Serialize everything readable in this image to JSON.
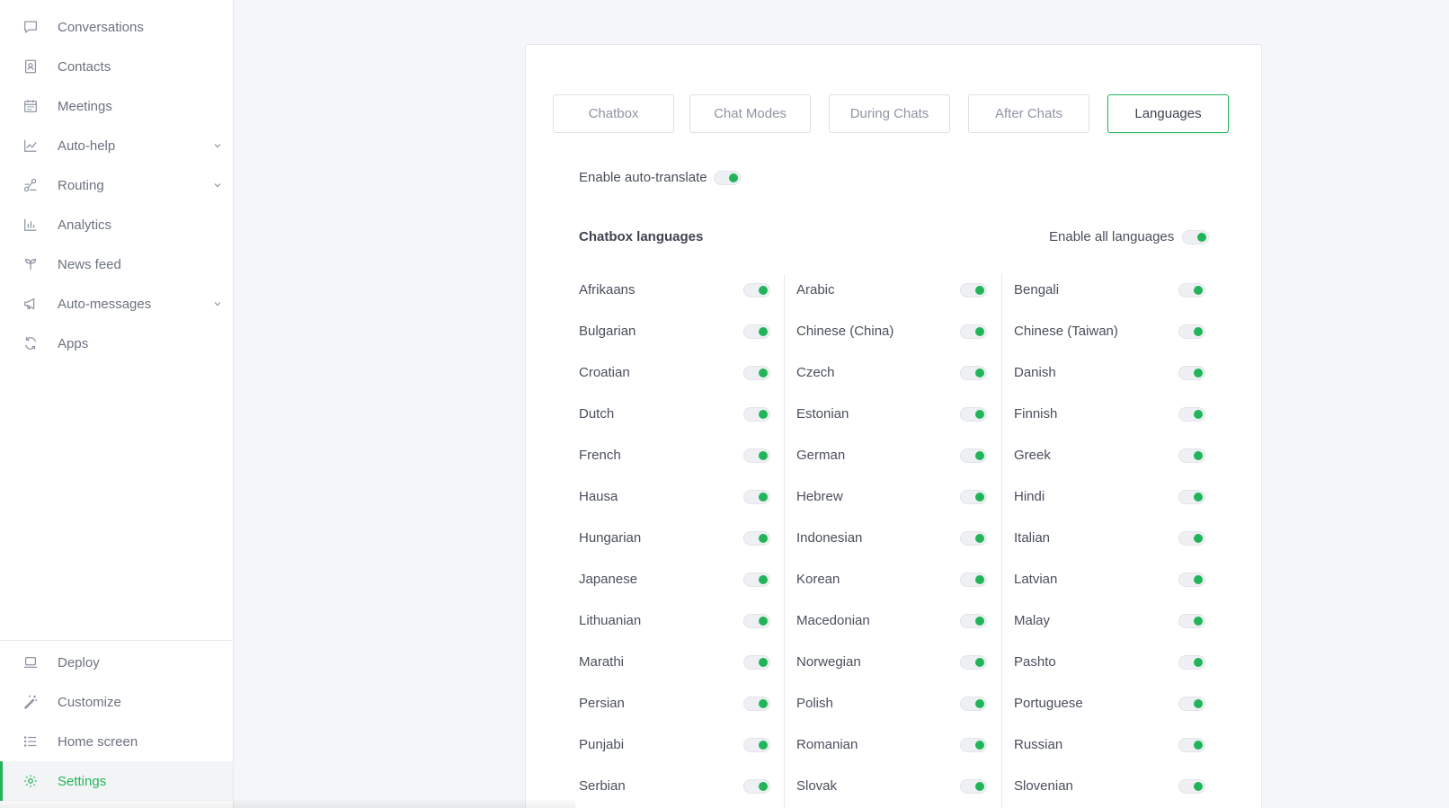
{
  "sidebar": {
    "items": [
      {
        "label": "Conversations",
        "icon": "chat-bubble-icon",
        "chevron": false
      },
      {
        "label": "Contacts",
        "icon": "contact-card-icon",
        "chevron": false
      },
      {
        "label": "Meetings",
        "icon": "calendar-icon",
        "chevron": false
      },
      {
        "label": "Auto-help",
        "icon": "trend-chart-icon",
        "chevron": true
      },
      {
        "label": "Routing",
        "icon": "routing-icon",
        "chevron": true
      },
      {
        "label": "Analytics",
        "icon": "bar-chart-icon",
        "chevron": false
      },
      {
        "label": "News feed",
        "icon": "sprout-icon",
        "chevron": false
      },
      {
        "label": "Auto-messages",
        "icon": "megaphone-icon",
        "chevron": true
      },
      {
        "label": "Apps",
        "icon": "refresh-icon",
        "chevron": false
      }
    ],
    "bottom_items": [
      {
        "label": "Deploy",
        "icon": "laptop-icon"
      },
      {
        "label": "Customize",
        "icon": "magic-wand-icon"
      },
      {
        "label": "Home screen",
        "icon": "list-icon"
      },
      {
        "label": "Settings",
        "icon": "gear-icon",
        "active": true
      }
    ]
  },
  "tabs": [
    {
      "label": "Chatbox",
      "active": false
    },
    {
      "label": "Chat Modes",
      "active": false
    },
    {
      "label": "During Chats",
      "active": false
    },
    {
      "label": "After Chats",
      "active": false
    },
    {
      "label": "Languages",
      "active": true
    }
  ],
  "auto_translate": {
    "label": "Enable auto-translate",
    "enabled": true
  },
  "chatbox_languages": {
    "title": "Chatbox languages",
    "enable_all_label": "Enable all languages",
    "enable_all": true,
    "columns": [
      [
        "Afrikaans",
        "Bulgarian",
        "Croatian",
        "Dutch",
        "French",
        "Hausa",
        "Hungarian",
        "Japanese",
        "Lithuanian",
        "Marathi",
        "Persian",
        "Punjabi",
        "Serbian"
      ],
      [
        "Arabic",
        "Chinese (China)",
        "Czech",
        "Estonian",
        "German",
        "Hebrew",
        "Indonesian",
        "Korean",
        "Macedonian",
        "Norwegian",
        "Polish",
        "Romanian",
        "Slovak"
      ],
      [
        "Bengali",
        "Chinese (Taiwan)",
        "Danish",
        "Finnish",
        "Greek",
        "Hindi",
        "Italian",
        "Latvian",
        "Malay",
        "Pashto",
        "Portuguese",
        "Russian",
        "Slovenian"
      ]
    ]
  },
  "colors": {
    "accent": "#22b45a",
    "text": "#4a4f5c",
    "muted": "#8e95a3"
  }
}
